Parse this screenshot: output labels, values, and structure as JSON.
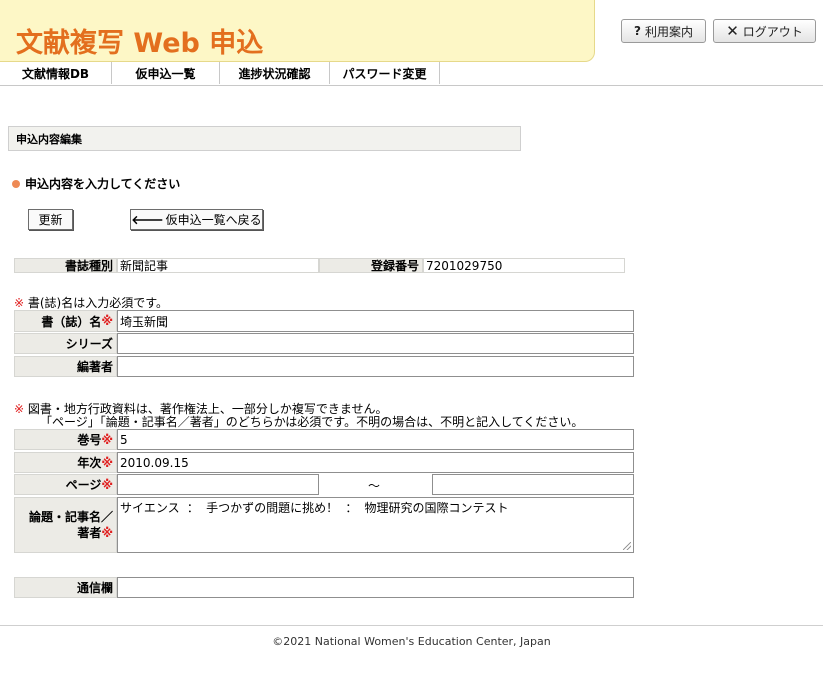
{
  "header": {
    "logo": "文献複写 Web 申込",
    "help_label": "利用案内",
    "logout_label": "ログアウト"
  },
  "nav": {
    "items": [
      "文献情報DB",
      "仮申込一覧",
      "進捗状況確認",
      "パスワード変更"
    ]
  },
  "section": {
    "title": "申込内容編集",
    "lead": "申込内容を入力してください"
  },
  "buttons": {
    "update": "更新",
    "back": "仮申込一覧へ戻る"
  },
  "meta": {
    "type_label": "書誌種別",
    "type_value": "新聞記事",
    "regno_label": "登録番号",
    "regno_value": "7201029750"
  },
  "note1": {
    "mark": "※",
    "text": " 書(誌)名は入力必須です。"
  },
  "form1": {
    "title_label": "書（誌）名",
    "title_value": "埼玉新聞",
    "series_label": "シリーズ",
    "series_value": "",
    "editor_label": "編著者",
    "editor_value": ""
  },
  "note2": {
    "mark": "※",
    "line1": "  図書・地方行政資料は、著作権法上、一部分しか複写できません。",
    "line2": "「ページ」「論題・記事名／著者」のどちらかは必須です。不明の場合は、不明と記入してください。"
  },
  "form2": {
    "volume_label": "巻号",
    "volume_value": "5",
    "year_label": "年次",
    "year_value": "2010.09.15",
    "page_label": "ページ",
    "page_from": "",
    "page_sep": "～",
    "page_to": "",
    "article_label_1": "論題・記事名／",
    "article_label_2": "著者",
    "article_value": "サイエンス ： 手つかずの問題に挑め！ ： 物理研究の国際コンテスト",
    "comm_label": "通信欄",
    "comm_value": ""
  },
  "required_mark": "※",
  "footer": "©2021 National Women's Education Center, Japan"
}
